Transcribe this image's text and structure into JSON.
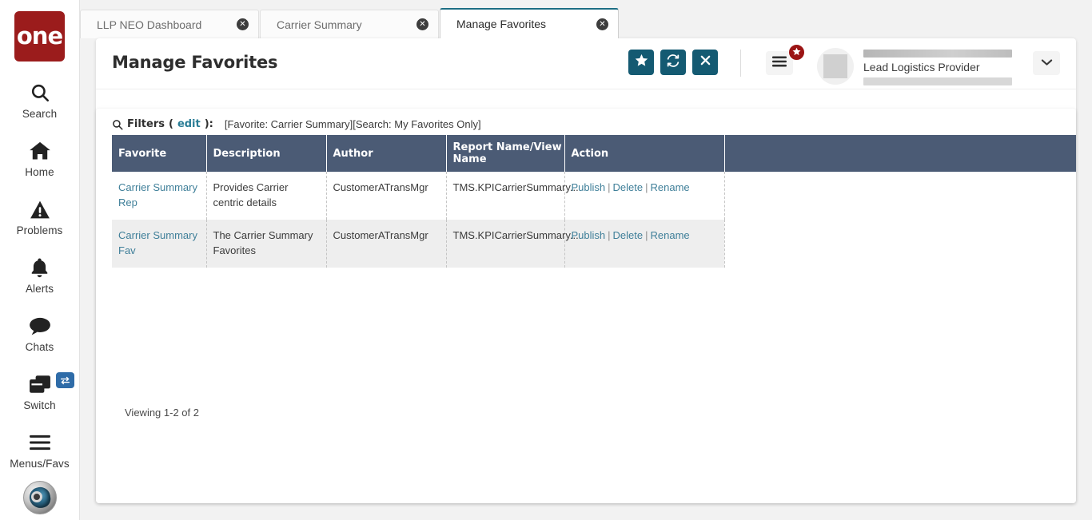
{
  "brand": {
    "logo_text": "one"
  },
  "sidebar": {
    "items": [
      {
        "label": "Search",
        "icon": "search-icon"
      },
      {
        "label": "Home",
        "icon": "home-icon"
      },
      {
        "label": "Problems",
        "icon": "warning-triangle-icon"
      },
      {
        "label": "Alerts",
        "icon": "bell-icon"
      },
      {
        "label": "Chats",
        "icon": "chat-bubble-icon"
      },
      {
        "label": "Switch",
        "icon": "windows-stack-icon",
        "badge_icon": "swap-arrows-icon"
      },
      {
        "label": "Menus/Favs",
        "icon": "hamburger-icon"
      }
    ],
    "avatar": {
      "icon": "ai-assistant-avatar"
    }
  },
  "tabs": [
    {
      "label": "LLP NEO Dashboard",
      "active": false,
      "close_icon": "close-circle-icon"
    },
    {
      "label": "Carrier Summary",
      "active": false,
      "close_icon": "close-circle-icon"
    },
    {
      "label": "Manage Favorites",
      "active": true,
      "close_icon": "close-circle-icon"
    }
  ],
  "header": {
    "title": "Manage Favorites",
    "actions": [
      {
        "name": "favorite-button",
        "icon": "star-icon"
      },
      {
        "name": "refresh-button",
        "icon": "refresh-icon"
      },
      {
        "name": "close-button",
        "icon": "x-icon"
      }
    ],
    "menus_favs": {
      "icon": "hamburger-icon",
      "badge_icon": "star-icon"
    },
    "user": {
      "role": "Lead Logistics Provider",
      "avatar_icon": "user-avatar-placeholder",
      "caret_icon": "chevron-down-icon"
    }
  },
  "filters": {
    "icon": "search-icon",
    "label": "Filters",
    "edit_link": "edit",
    "colon": "):",
    "open_paren": "(",
    "value": "[Favorite: Carrier Summary][Search: My Favorites Only]"
  },
  "table": {
    "columns": [
      "Favorite",
      "Description",
      "Author",
      "Report Name/View Name",
      "Action",
      ""
    ],
    "rows": [
      {
        "favorite": "Carrier Summary Rep",
        "description": "Provides Carrier centric details",
        "author": "CustomerATransMgr",
        "report_name": "TMS.KPICarrierSummary...",
        "actions": [
          "Publish",
          "Delete",
          "Rename"
        ]
      },
      {
        "favorite": "Carrier Summary Fav",
        "description": "The Carrier Summary Favorites",
        "author": "CustomerATransMgr",
        "report_name": "TMS.KPICarrierSummary...",
        "actions": [
          "Publish",
          "Delete",
          "Rename"
        ]
      }
    ],
    "action_separator": "|"
  },
  "footer": {
    "viewing": "Viewing 1-2 of 2"
  },
  "colors": {
    "brand_red": "#9b1c1c",
    "accent_teal": "#145a72",
    "table_header": "#4b5b75",
    "link": "#3f7f99",
    "row_alt": "#eeeeee",
    "badge_red": "#9b1414",
    "switch_badge_blue": "#2f6ca8"
  }
}
